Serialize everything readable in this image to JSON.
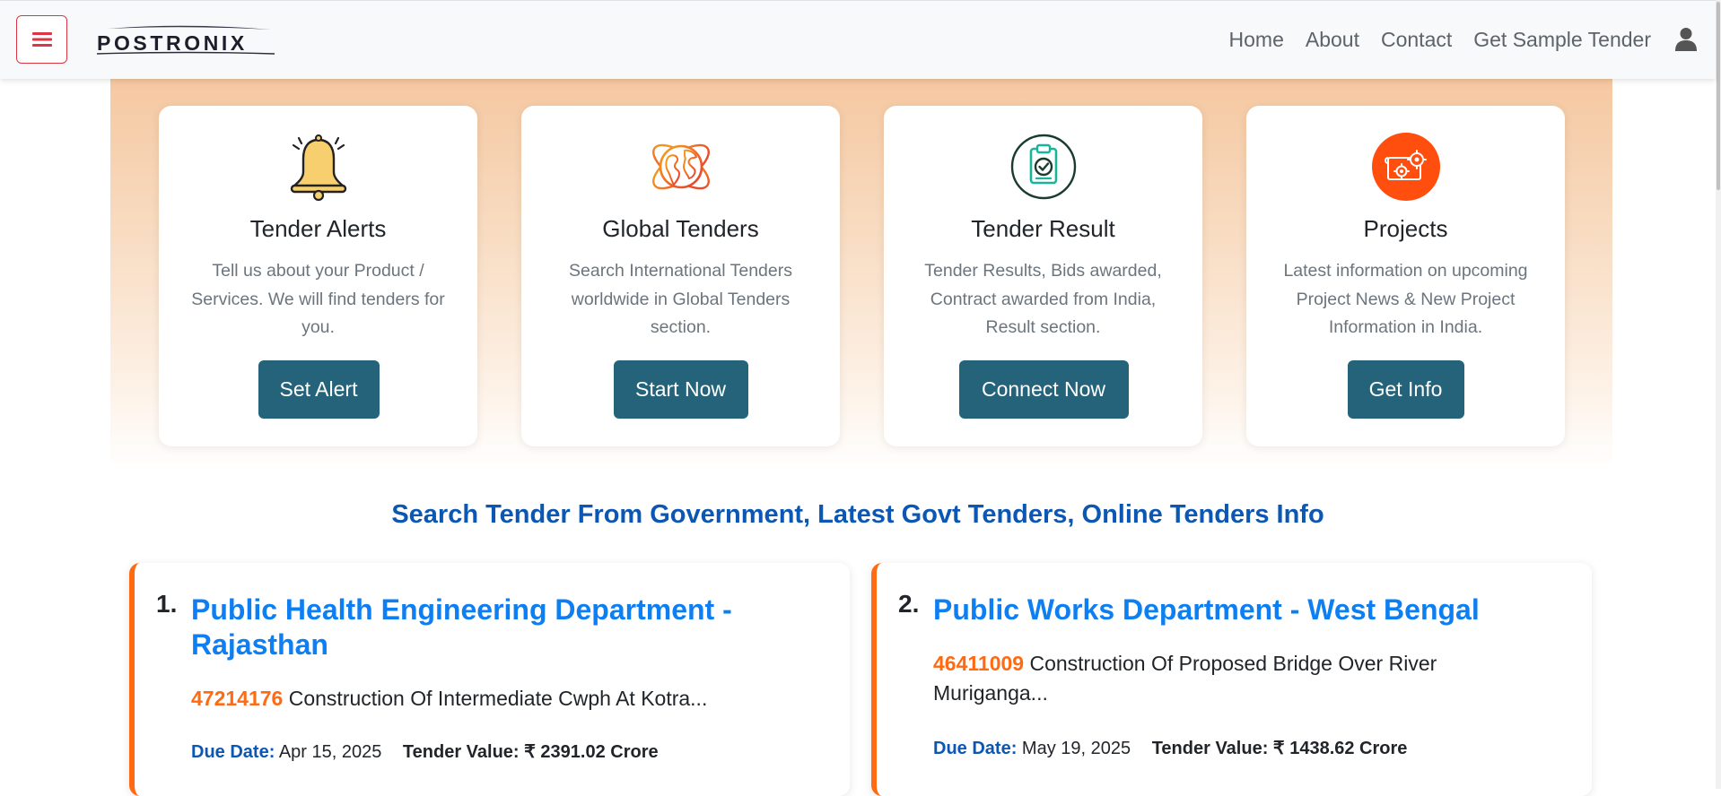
{
  "header": {
    "brand": "POSTRONIX",
    "nav": [
      "Home",
      "About",
      "Contact",
      "Get Sample Tender"
    ]
  },
  "services": [
    {
      "title": "Tender Alerts",
      "desc": "Tell us about your Product / Services. We will find tenders for you.",
      "button": "Set Alert",
      "icon": "bell-icon"
    },
    {
      "title": "Global Tenders",
      "desc": "Search International Tenders worldwide in Global Tenders section.",
      "button": "Start Now",
      "icon": "globe-icon"
    },
    {
      "title": "Tender Result",
      "desc": "Tender Results, Bids awarded, Contract awarded from India, Result section.",
      "button": "Connect Now",
      "icon": "clipboard-check-icon"
    },
    {
      "title": "Projects",
      "desc": "Latest information on upcoming Project News & New Project Information in India.",
      "button": "Get Info",
      "icon": "blueprint-gear-icon"
    }
  ],
  "section_title": "Search Tender From Government, Latest Govt Tenders, Online Tenders Info",
  "tenders": [
    {
      "num": "1.",
      "title": "Public Health Engineering Department - Rajasthan",
      "id": "47214176",
      "desc": "Construction Of Intermediate Cwph At Kotra...",
      "due_label": "Due Date:",
      "due": "Apr 15, 2025",
      "value_label": "Tender Value:",
      "value": "₹ 2391.02 Crore"
    },
    {
      "num": "2.",
      "title": "Public Works Department - West Bengal",
      "id": "46411009",
      "desc": "Construction Of Proposed Bridge Over River Muriganga...",
      "due_label": "Due Date:",
      "due": "May 19, 2025",
      "value_label": "Tender Value:",
      "value": "₹ 1438.62 Crore"
    }
  ],
  "colors": {
    "accent_button": "#24637a",
    "heading_blue": "#0b57b3",
    "link_blue": "#0d7ff2",
    "orange": "#ff6a13",
    "menu_red": "#dc3545"
  }
}
